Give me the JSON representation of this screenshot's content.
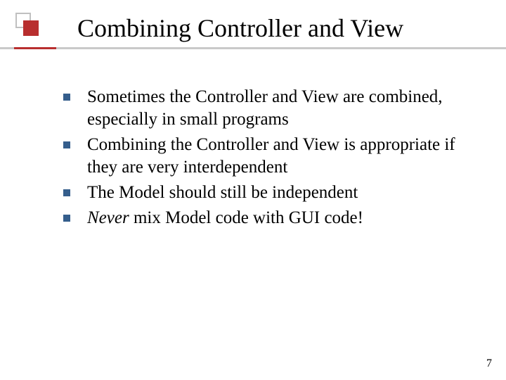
{
  "slide": {
    "title": "Combining Controller and View",
    "bullets": [
      {
        "text": "Sometimes the Controller and View are combined, especially in small programs"
      },
      {
        "text": "Combining the Controller and View is appropriate if they are very interdependent"
      },
      {
        "text": "The Model should still be independent"
      },
      {
        "italic_lead": "Never",
        "rest": " mix Model code with GUI code!"
      }
    ],
    "page_number": "7"
  },
  "colors": {
    "accent_red": "#b82e2e",
    "bullet_blue": "#355e8c",
    "rule_gray": "#c9c9c9"
  }
}
